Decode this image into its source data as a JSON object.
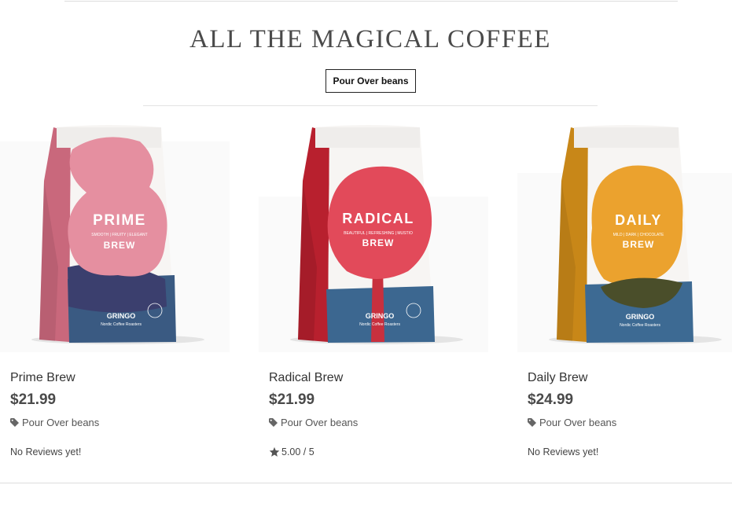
{
  "page": {
    "heading": "ALL THE MAGICAL COFFEE",
    "filter_button": "Pour Over beans"
  },
  "products": [
    {
      "name": "Prime Brew",
      "price": "$21.99",
      "tag": "Pour Over beans",
      "review": "No Reviews yet!",
      "bag": {
        "title": "PRIME",
        "subtitle": "BREW",
        "descriptor": "SMOOTH | FRUITY | ELEGANT",
        "brand": "GRINGO",
        "brand_sub": "Nordic Coffee Roasters",
        "accent": "#e58fa0",
        "side": "#c9687c",
        "lower": "#3a5a82",
        "lower_dark": "#3b3f6e"
      }
    },
    {
      "name": "Radical Brew",
      "price": "$21.99",
      "tag": "Pour Over beans",
      "review": "5.00 / 5",
      "bag": {
        "title": "RADICAL",
        "subtitle": "BREW",
        "descriptor": "BEAUTIFUL | REFRESHING | MUSTIO",
        "brand": "GRINGO",
        "brand_sub": "Nordic Coffee Roasters",
        "accent": "#e24a5a",
        "side": "#b8202e",
        "lower": "#3c6790",
        "lower_dark": "#c8303e"
      }
    },
    {
      "name": "Daily Brew",
      "price": "$24.99",
      "tag": "Pour Over beans",
      "review": "No Reviews yet!",
      "bag": {
        "title": "DAILY",
        "subtitle": "BREW",
        "descriptor": "MILD | DARK | CHOCOLATE",
        "brand": "GRINGO",
        "brand_sub": "Nordic Coffee Roasters",
        "accent": "#eba22e",
        "side": "#c88718",
        "lower": "#3d6a93",
        "lower_dark": "#4a4e2a"
      }
    }
  ],
  "icons": {
    "tag": "tag-icon",
    "star": "star-icon"
  }
}
